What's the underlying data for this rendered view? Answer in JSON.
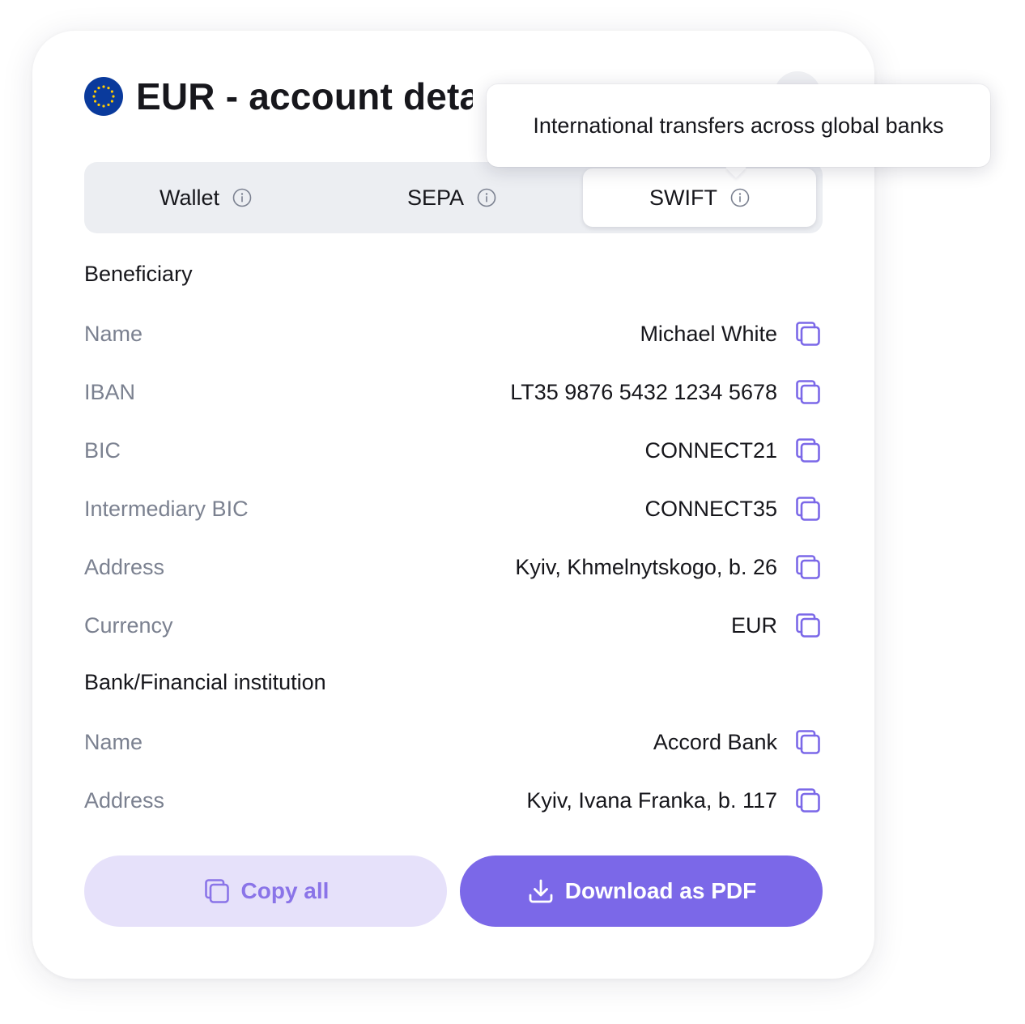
{
  "header": {
    "title": "EUR - account details"
  },
  "tabs": [
    {
      "label": "Wallet",
      "icon": "info-icon"
    },
    {
      "label": "SEPA",
      "icon": "info-icon"
    },
    {
      "label": "SWIFT",
      "icon": "info-icon",
      "active": true
    }
  ],
  "tooltip": {
    "text": "International transfers across global banks"
  },
  "beneficiary": {
    "title": "Beneficiary",
    "rows": [
      {
        "label": "Name",
        "value": "Michael White"
      },
      {
        "label": "IBAN",
        "value": "LT35 9876 5432 1234 5678"
      },
      {
        "label": "BIC",
        "value": "CONNECT21"
      },
      {
        "label": "Intermediary BIC",
        "value": "CONNECT35"
      },
      {
        "label": "Address",
        "value": "Kyiv, Khmelnytskogo, b. 26"
      },
      {
        "label": "Currency",
        "value": "EUR"
      }
    ]
  },
  "bank": {
    "title": "Bank/Financial institution",
    "rows": [
      {
        "label": "Name",
        "value": "Accord Bank"
      },
      {
        "label": "Address",
        "value": "Kyiv, Ivana Franka, b. 117"
      }
    ]
  },
  "actions": {
    "copy_all": "Copy all",
    "download_pdf": "Download as PDF"
  },
  "colors": {
    "accent": "#7b68e8",
    "accent_light": "#e6e1fa",
    "eu_blue": "#0a3a9c",
    "eu_star": "#ffcc00",
    "label_gray": "#7b8190"
  }
}
